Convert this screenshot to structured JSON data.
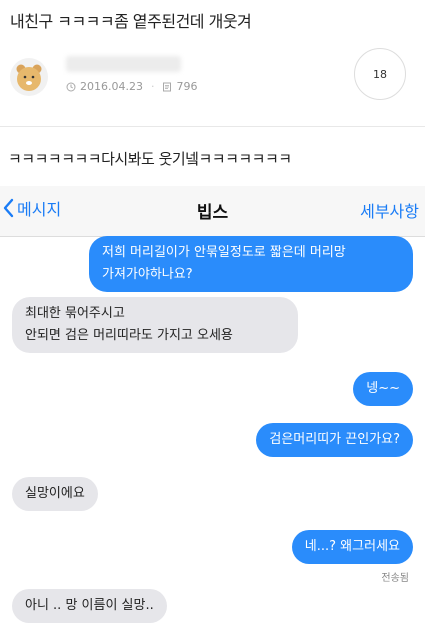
{
  "post": {
    "title": "내친구 ㅋㅋㅋㅋ좀 옅주된건데 개웃겨",
    "date": "2016.04.23",
    "views": "796",
    "comments": "18",
    "body_text": "ㅋㅋㅋㅋㅋㅋㅋ다시봐도 웃기넼ㅋㅋㅋㅋㅋㅋㅋ"
  },
  "chat": {
    "back_label": "메시지",
    "title": "빕스",
    "detail_label": "세부사항",
    "messages": [
      {
        "from": "me",
        "line1": "저희 머리길이가 안묶일정도로 짧은데 머리망",
        "line2": "가져가야하나요?"
      },
      {
        "from": "other",
        "line1": "최대한 묶어주시고",
        "line2": "안되면 검은 머리띠라도 가지고 오세용"
      },
      {
        "from": "me",
        "text": "넹~~"
      },
      {
        "from": "me",
        "text": "검은머리띠가 끈인가요?"
      },
      {
        "from": "other",
        "text": "실망이에요"
      },
      {
        "from": "me",
        "text": "네...? 왜그러세요"
      },
      {
        "from": "other",
        "text": "아니 .. 망 이름이 실망.."
      }
    ],
    "status": "전송됨"
  },
  "icons": [
    "kakao-ryan-avatar",
    "clock-icon",
    "document-icon",
    "chevron-left-icon"
  ],
  "colors": {
    "outgoing": "#2a8cfb",
    "incoming": "#e6e6ea",
    "accent": "#1a7cf6"
  }
}
